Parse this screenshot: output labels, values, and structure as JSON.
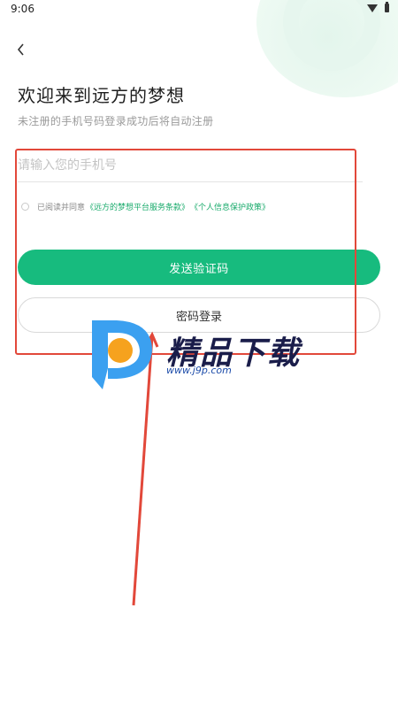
{
  "status_bar": {
    "time": "9:06",
    "wifi_icon": "wifi-icon",
    "battery_icon": "battery-icon"
  },
  "header": {
    "back_icon": "chevron-left-icon"
  },
  "main": {
    "title": "欢迎来到远方的梦想",
    "subtitle": "未注册的手机号码登录成功后将自动注册",
    "phone_placeholder": "请输入您的手机号",
    "agreement": {
      "prefix": "已阅读并同意",
      "terms_link": "《远方的梦想平台服务条款》",
      "privacy_link": "《个人信息保护政策》"
    },
    "send_code_button": "发送验证码",
    "password_login_button": "密码登录"
  },
  "watermark": {
    "text": "精品下载",
    "url": "www.j9p.com"
  },
  "colors": {
    "accent": "#17bb7e",
    "link": "#1aab6c",
    "annotation": "#e2483a"
  }
}
